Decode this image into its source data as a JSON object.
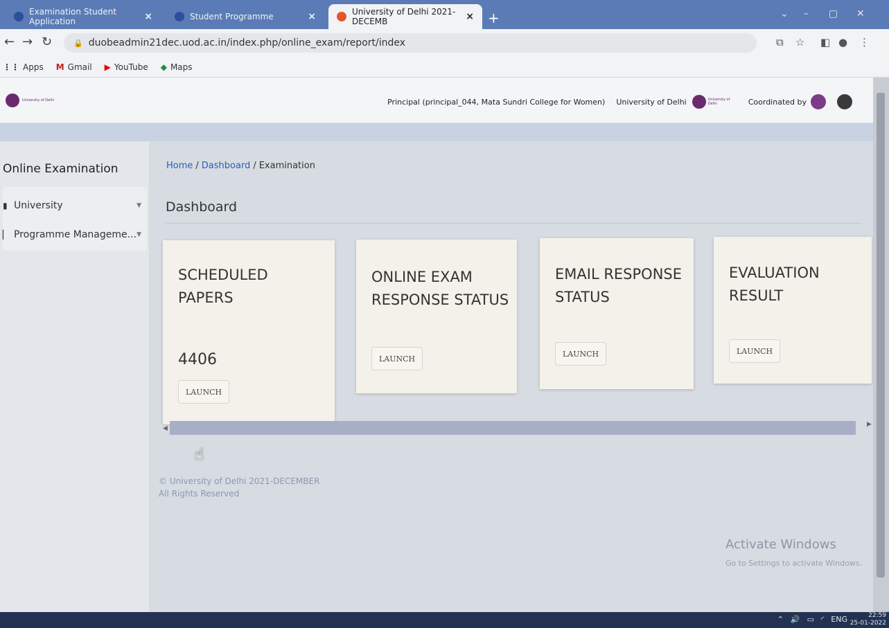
{
  "browser": {
    "tabs": [
      {
        "label": "Examination Student Application",
        "color": "#2d4f9b"
      },
      {
        "label": "Student Programme",
        "color": "#2d4f9b"
      },
      {
        "label": "University of Delhi 2021-DECEMB",
        "color": "#e4572e"
      }
    ],
    "url": "duobeadmin21dec.uod.ac.in/index.php/online_exam/report/index",
    "bookmarks": [
      "Apps",
      "Gmail",
      "YouTube",
      "Maps"
    ]
  },
  "header": {
    "logo_text": "University of Delhi",
    "user_role": "Principal (principal_044, Mata Sundri College for Women)",
    "university": "University of Delhi",
    "coordinated_by": "Coordinated by"
  },
  "sidebar": {
    "title": "Online Examination",
    "items": [
      {
        "label": "University"
      },
      {
        "label": "Programme Manageme..."
      }
    ]
  },
  "breadcrumb": {
    "home": "Home",
    "dashboard": "Dashboard",
    "current": "Examination"
  },
  "page_title": "Dashboard",
  "cards": [
    {
      "title": "SCHEDULED PAPERS",
      "value": "4406",
      "button": "LAUNCH"
    },
    {
      "title": "ONLINE EXAM RESPONSE STATUS",
      "button": "LAUNCH"
    },
    {
      "title": "EMAIL RESPONSE STATUS",
      "button": "LAUNCH"
    },
    {
      "title": "EVALUATION RESULT",
      "button": "LAUNCH"
    }
  ],
  "footer": {
    "line1": "© University of Delhi 2021-DECEMBER",
    "line2": "All Rights Reserved"
  },
  "watermark": {
    "title": "Activate Windows",
    "subtitle": "Go to Settings to activate Windows."
  },
  "taskbar": {
    "lang": "ENG",
    "time": "22:59",
    "date": "25-01-2022"
  },
  "colors": {
    "accent": "#2a5db8",
    "brand": "#6a2a6f"
  }
}
